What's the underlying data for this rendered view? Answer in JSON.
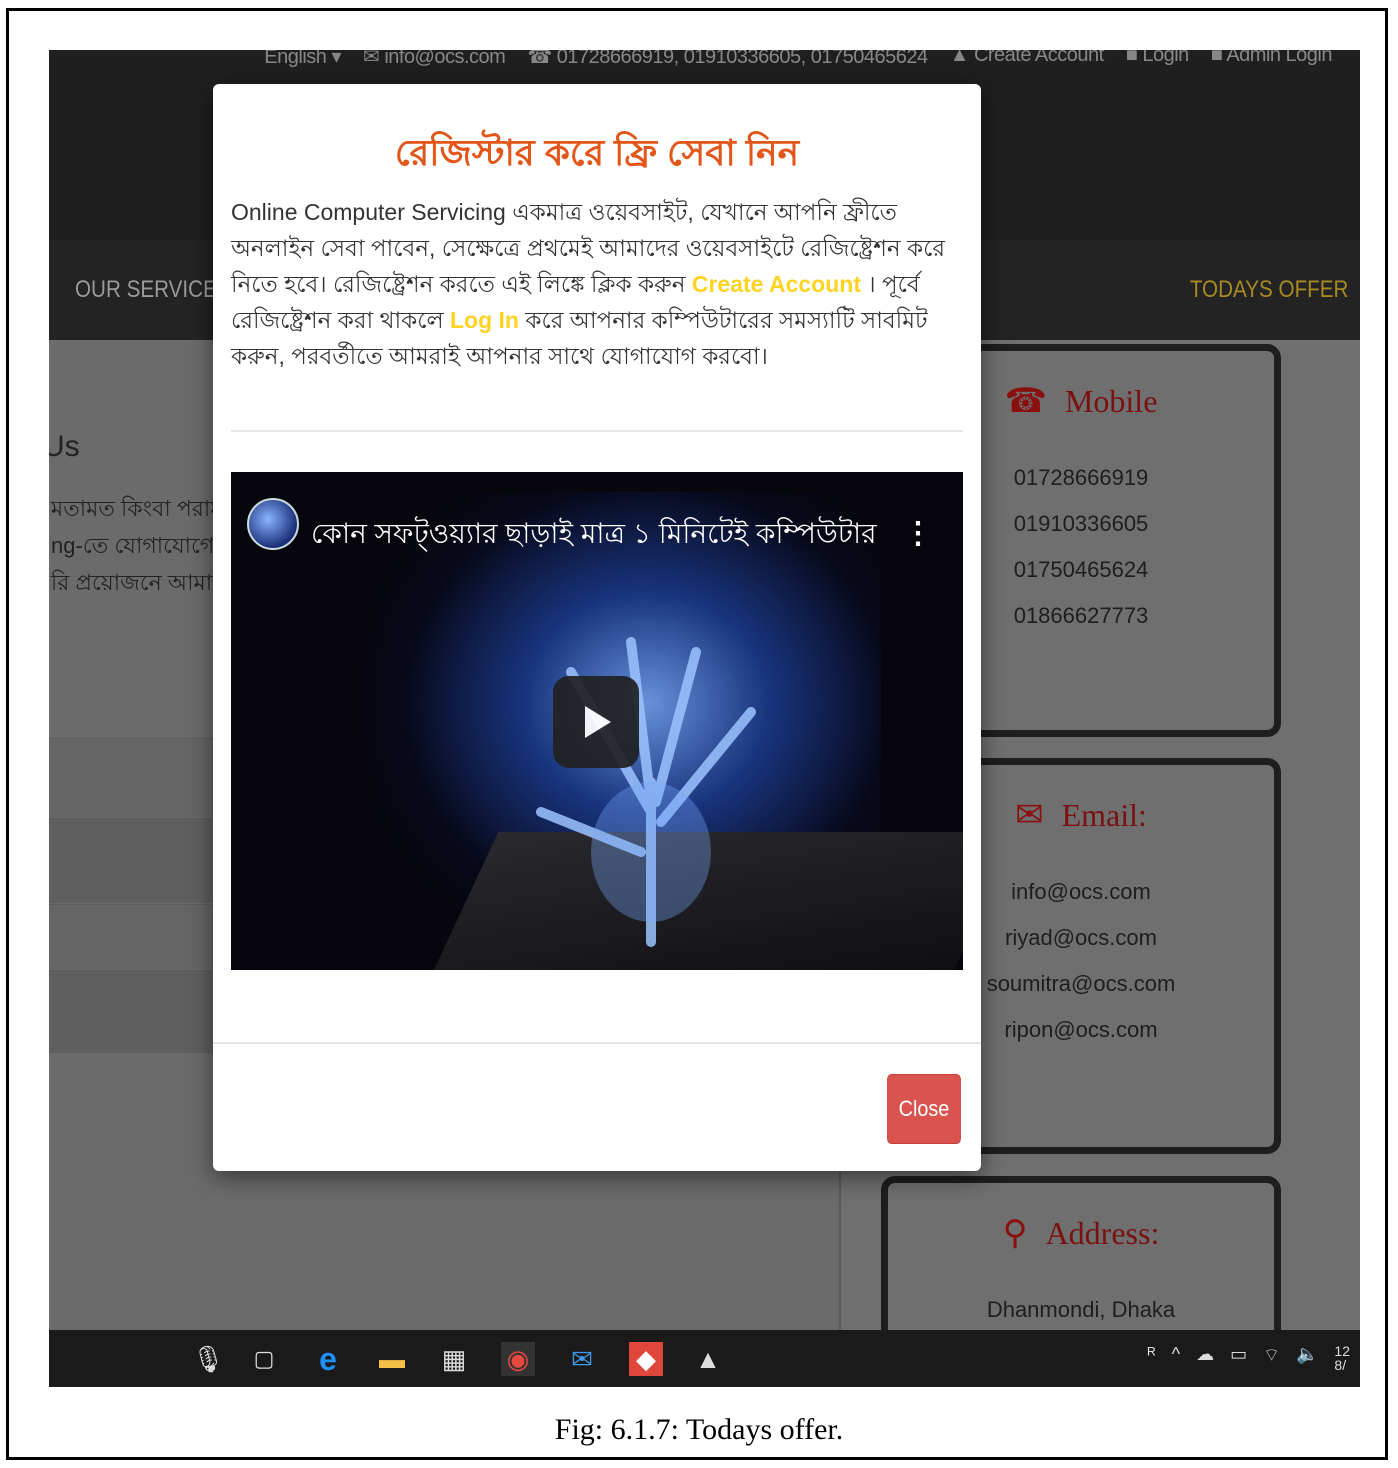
{
  "topbar": {
    "language": "English ▾",
    "email": "✉ info@ocs.com",
    "phones": "☎ 01728666919, 01910336605, 01750465624",
    "create_account": "▲ Create Account",
    "login": "■ Login",
    "admin_login": "■ Admin Login"
  },
  "nav": {
    "our_services": "OUR SERVICES",
    "todays_offer": "TODAYS OFFER"
  },
  "contact": {
    "title": "Us",
    "lines": [
      "মতামত কিংবা পরাম",
      "ng-তে যোগাযোগের",
      "রি প্রয়োজনে আমাদে"
    ]
  },
  "cards": {
    "mobile": {
      "title": "Mobile",
      "lines": [
        "01728666919",
        "01910336605",
        "01750465624",
        "01866627773"
      ]
    },
    "email": {
      "title": "Email:",
      "lines": [
        "info@ocs.com",
        "riyad@ocs.com",
        "soumitra@ocs.com",
        "ripon@ocs.com"
      ]
    },
    "address": {
      "title": "Address:",
      "lines": [
        "Dhanmondi, Dhaka"
      ]
    }
  },
  "modal": {
    "title": "রেজিস্টার করে ফ্রি সেবা নিন",
    "body_part1": "Online Computer Servicing একমাত্র ওয়েবসাইট, যেখানে আপনি ফ্রীতে অনলাইন সেবা পাবেন, সেক্ষেত্রে প্রথমেই আমাদের ওয়েবসাইটে রেজিষ্ট্রেশন করে নিতে হবে। রেজিষ্ট্রেশন করতে এই লিঙ্কে ক্লিক করুন",
    "link_create": "Create Account",
    "body_part2": "। পূর্বে রেজিষ্ট্রেশন করা থাকলে",
    "link_login": "Log In",
    "body_part3": "করে আপনার কম্পিউটারের সমস্যাটি সাবমিট করুন, পরবর্তীতে আমরাই আপনার সাথে যোগাযোগ করবো।",
    "video_title": "কোন সফট্ওয়্যার ছাড়াই মাত্র ১ মিনিটেই কম্পিউটার পাস...",
    "close_label": "Close"
  },
  "taskbar": {
    "time_partial": "12",
    "date_partial": "8/"
  },
  "caption": "Fig: 6.1.7:  Todays offer.",
  "colors": {
    "modal_title": "#e2561a",
    "link_yellow": "#ffd321",
    "close_button": "#d9534f",
    "offer_gold": "#a88a20"
  }
}
